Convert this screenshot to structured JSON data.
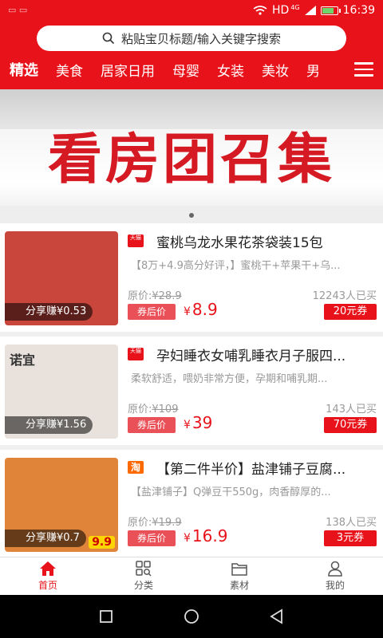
{
  "status": {
    "network": "HD",
    "signal_badge": "4G",
    "time": "16:39",
    "battery_level": 0.85
  },
  "search": {
    "placeholder": "粘贴宝贝标题/输入关键字搜索"
  },
  "tabs": [
    "精选",
    "美食",
    "居家日用",
    "母婴",
    "女装",
    "美妆",
    "男"
  ],
  "banner": {
    "title": "看房团召集",
    "dot_count": 1
  },
  "products": [
    {
      "platform": "天猫",
      "title": "蜜桃乌龙水果花茶袋装15包",
      "desc": "【8万+4.9高分好评，】蜜桃干+苹果干+乌...",
      "orig_label": "原价:",
      "orig_price": "¥28.9",
      "sold": "12243人已买",
      "after_label": "券后价",
      "price_currency": "¥",
      "price": "8.9",
      "coupon": "20元券",
      "share": "分享赚¥0.53",
      "thumb_bg": "#c9463d"
    },
    {
      "platform": "天猫",
      "title": "孕妇睡衣女哺乳睡衣月子服四...",
      "desc": "柔软舒适，喂奶非常方便，孕期和哺乳期...",
      "orig_label": "原价:",
      "orig_price": "¥109",
      "sold": "143人已买",
      "after_label": "券后价",
      "price_currency": "¥",
      "price": "39",
      "coupon": "70元券",
      "share": "分享赚¥1.56",
      "thumb_label": "诺宜",
      "thumb_bg": "#e9e2dc"
    },
    {
      "platform": "淘",
      "title": "【第二件半价】盐津铺子豆腐...",
      "desc": "【盐津铺子】Q弹豆干550g，肉香醇厚的...",
      "orig_label": "原价:",
      "orig_price": "¥19.9",
      "sold": "138人已买",
      "after_label": "券后价",
      "price_currency": "¥",
      "price": "16.9",
      "coupon": "3元券",
      "share": "分享赚¥0.7",
      "thumb_badge": "9.9",
      "thumb_bg": "#e0843a"
    }
  ],
  "bottom_nav": [
    {
      "label": "首页",
      "active": true
    },
    {
      "label": "分类",
      "active": false
    },
    {
      "label": "素材",
      "active": false
    },
    {
      "label": "我的",
      "active": false
    }
  ],
  "colors": {
    "brand": "#e8131a",
    "price": "#e8131a",
    "coupon": "#e8131a",
    "muted": "#999999"
  }
}
